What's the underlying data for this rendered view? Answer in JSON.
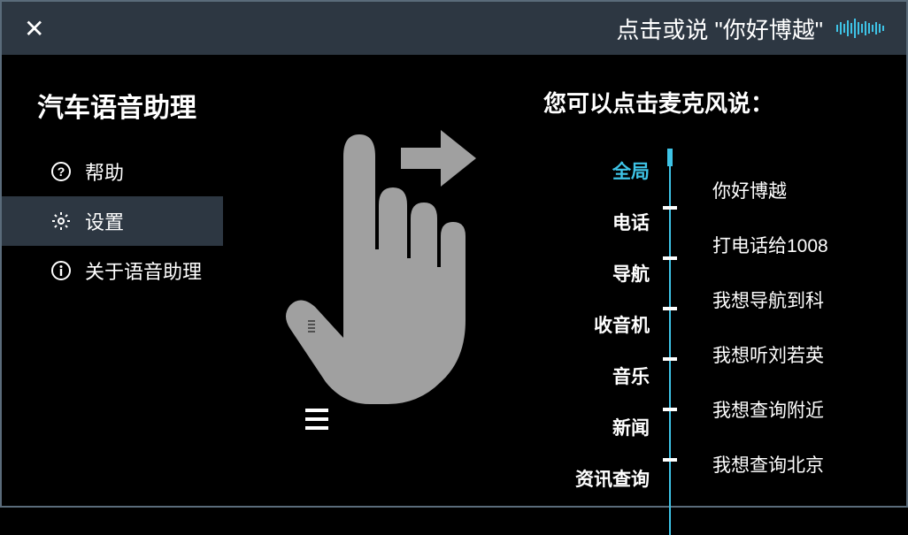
{
  "header": {
    "prompt": "点击或说 \"你好博越\""
  },
  "sidebar": {
    "title": "汽车语音助理",
    "items": [
      {
        "label": "帮助",
        "icon": "help"
      },
      {
        "label": "设置",
        "icon": "settings"
      },
      {
        "label": "关于语音助理",
        "icon": "info"
      }
    ]
  },
  "rightPanel": {
    "title": "您可以点击麦克风说：",
    "categories": [
      "全局",
      "电话",
      "导航",
      "收音机",
      "音乐",
      "新闻",
      "资讯查询"
    ],
    "examples": [
      "你好博越",
      "打电话给1008",
      "我想导航到科",
      "我想听刘若英",
      "我想查询附近",
      "我想查询北京"
    ]
  }
}
